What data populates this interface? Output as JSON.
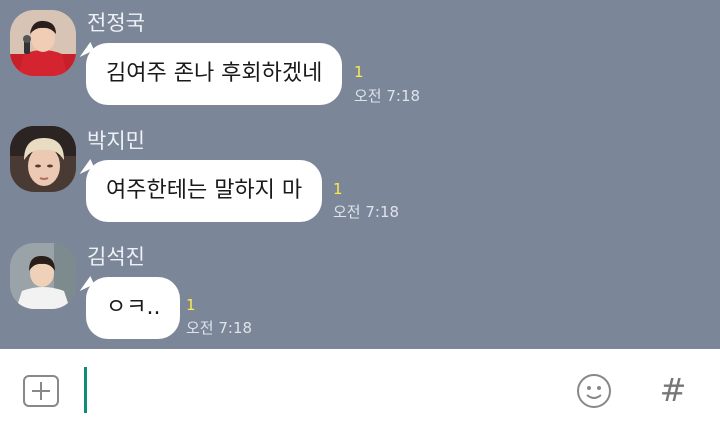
{
  "messages": [
    {
      "sender": "전정국",
      "text": "김여주 존나 후회하겠네",
      "unread": "1",
      "time": "오전 7:18",
      "avatar": "avatar-photo-red-jacket"
    },
    {
      "sender": "박지민",
      "text": "여주한테는 말하지 마",
      "unread": "1",
      "time": "오전 7:18",
      "avatar": "avatar-photo-blonde"
    },
    {
      "sender": "김석진",
      "text": "ㅇㅋ..",
      "unread": "1",
      "time": "오전 7:18",
      "avatar": "avatar-photo-white-shirt"
    }
  ],
  "input": {
    "value": "",
    "placeholder": "",
    "plus_icon": "plus-square-icon",
    "emoji_icon": "smiley-icon",
    "hash_label": "#"
  },
  "colors": {
    "chat_background": "#7b8698",
    "bubble": "#ffffff",
    "unread": "#ffe94a",
    "cursor": "#0e8c76"
  }
}
